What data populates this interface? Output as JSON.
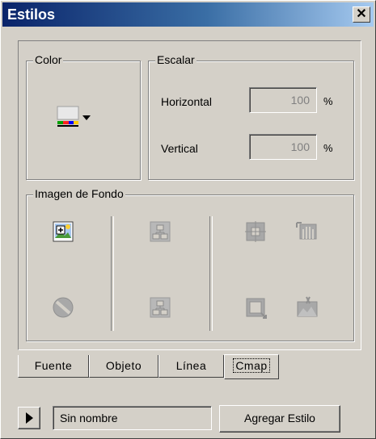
{
  "window": {
    "title": "Estilos",
    "close_glyph": "✕"
  },
  "color_group": {
    "legend": "Color",
    "color_button_icon": "fill-color-icon"
  },
  "scale_group": {
    "legend": "Escalar",
    "horizontal_label": "Horizontal",
    "horizontal_value": "100",
    "vertical_label": "Vertical",
    "vertical_value": "100",
    "unit": "%"
  },
  "background_group": {
    "legend": "Imagen de Fondo"
  },
  "tabs": [
    {
      "label": "Fuente"
    },
    {
      "label": "Objeto"
    },
    {
      "label": "Línea"
    },
    {
      "label": "Cmap",
      "active": true
    }
  ],
  "footer": {
    "style_name": "Sin nombre",
    "add_style_label": "Agregar Estilo"
  }
}
